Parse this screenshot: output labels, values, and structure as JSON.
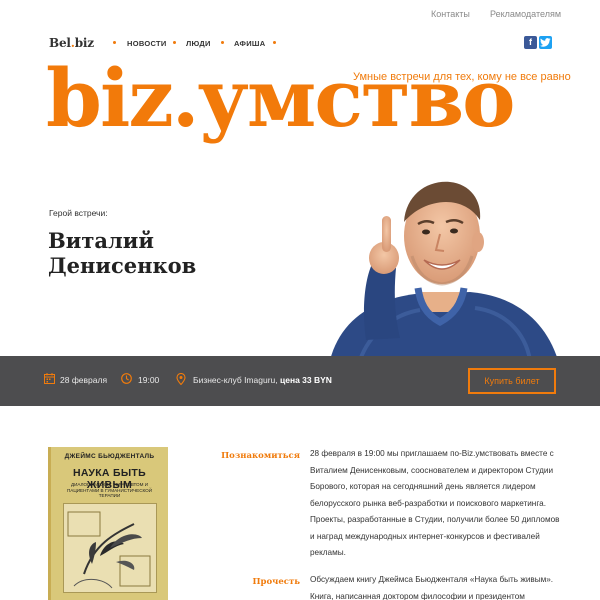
{
  "topbar": {
    "contacts": "Контакты",
    "advertisers": "Рекламодателям"
  },
  "nav": {
    "logo_part1": "Bel",
    "logo_dot": ".",
    "logo_part2": "biz",
    "items": [
      "НОВОСТИ",
      "ЛЮДИ",
      "АФИША"
    ],
    "social": [
      "facebook-icon",
      "twitter-icon"
    ]
  },
  "hero": {
    "tagline": "Умные встречи для тех, кому не все равно",
    "title": "biz.умство",
    "guest_label": "Герой встречи:",
    "guest_first_name": "Виталий",
    "guest_last_name": "Денисенков"
  },
  "event": {
    "date": "28 февраля",
    "time": "19:00",
    "place": "Бизнес-клуб Imaguru,",
    "price": "цена 33 BYN",
    "buy_button": "Купить билет"
  },
  "book": {
    "author": "ДЖЕЙМС БЬЮДЖЕНТАЛЬ",
    "title": "НАУКА БЫТЬ ЖИВЫМ",
    "subtitle": "ДИАЛОГИ МЕЖДУ ТЕРАПЕВТОМ И ПАЦИЕНТАМИ В ГУМАНИСТИЧЕСКОЙ ТЕРАПИИ"
  },
  "sections": [
    {
      "label": "Познакомиться",
      "lines": [
        "28 февраля в 19:00 мы приглашаем по-Biz.умствовать вместе с",
        "Виталием Денисенковым, сооснователем и директором Студии",
        "Борового, которая на сегодняшний день является лидером",
        "белорусского рынка веб-разработки и поискового маркетинга.",
        "Проекты, разработанные в Студии, получили более 50 дипломов",
        "и наград международных интернет-конкурсов и фестивалей",
        "рекламы."
      ]
    },
    {
      "label": "Прочесть",
      "lines": [
        "Обсуждаем книгу Джеймса Бьюдженталя «Наука быть живым».",
        "Книга, написанная доктором философии и президентом"
      ]
    }
  ],
  "colors": {
    "accent": "#f27a0a",
    "bar": "#4d4d4f",
    "text": "#333333"
  }
}
